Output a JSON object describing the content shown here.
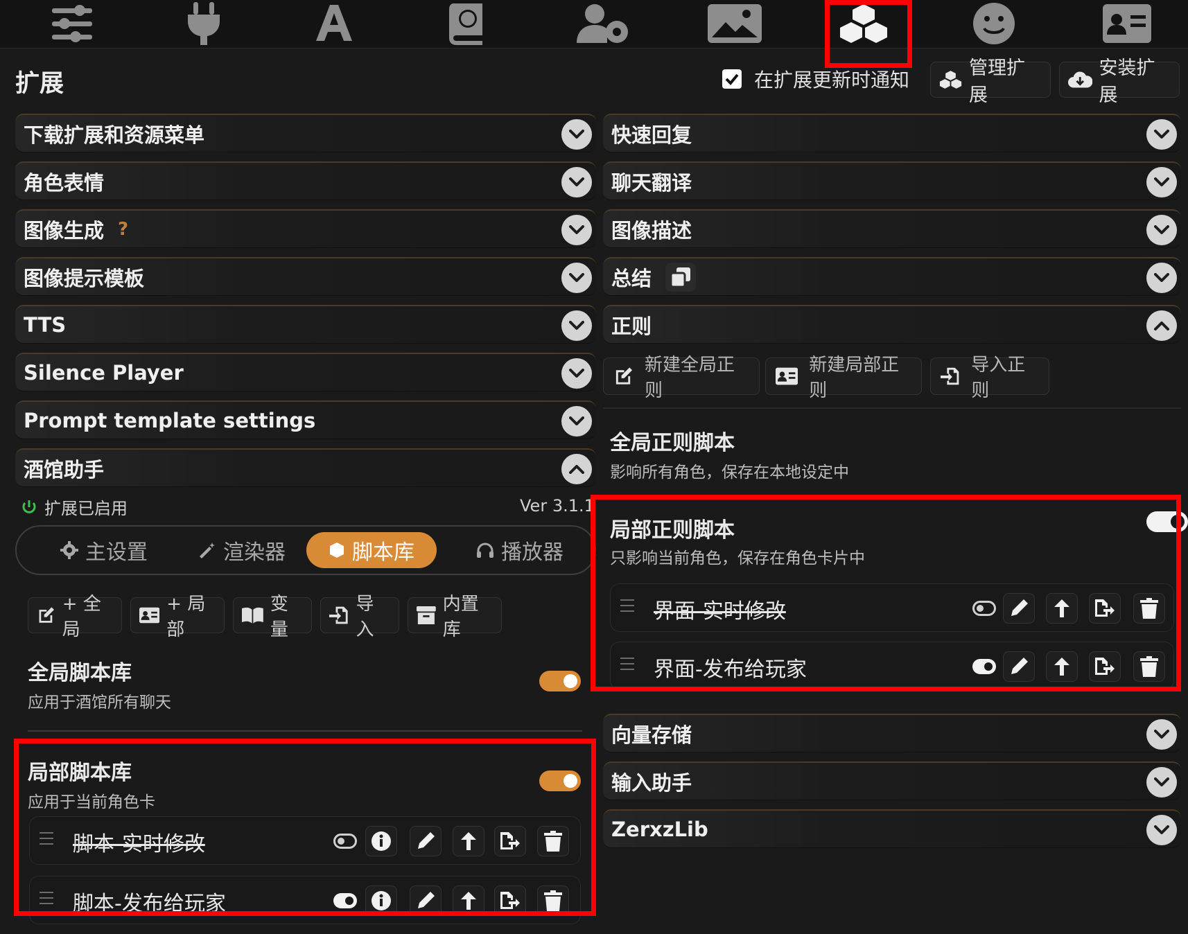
{
  "topnav": {
    "icons": [
      "sliders-icon",
      "plug-icon",
      "font-icon",
      "book-globe-icon",
      "user-gear-icon",
      "image-icon",
      "cubes-icon",
      "smiley-icon",
      "id-card-icon"
    ]
  },
  "header": {
    "title": "扩展",
    "notify_label": "在扩展更新时通知",
    "manage_label": "管理扩展",
    "install_label": "安装扩展"
  },
  "left": {
    "drawers": [
      "下载扩展和资源菜单",
      "角色表情",
      "图像生成",
      "图像提示模板",
      "TTS",
      "Silence Player",
      "Prompt template settings",
      "酒馆助手"
    ],
    "help_mark": "?",
    "helper": {
      "status": "扩展已启用",
      "version": "Ver 3.1.1",
      "tabs": [
        "主设置",
        "渲染器",
        "脚本库",
        "播放器"
      ],
      "active_tab": "脚本库",
      "toolbar": [
        "+ 全局",
        "+ 局部",
        "变量",
        "导入",
        "内置库"
      ],
      "global": {
        "title": "全局脚本库",
        "subtitle": "应用于酒馆所有聊天",
        "enabled": true
      },
      "local": {
        "title": "局部脚本库",
        "subtitle": "应用于当前角色卡",
        "enabled": true
      },
      "scripts": [
        {
          "name": "脚本-实时修改",
          "disabled": true
        },
        {
          "name": "脚本-发布给玩家",
          "disabled": false
        }
      ]
    }
  },
  "right": {
    "drawers_top": [
      "快速回复",
      "聊天翻译",
      "图像描述",
      "总结",
      "正则"
    ],
    "regex": {
      "buttons": [
        "新建全局正则",
        "新建局部正则",
        "导入正则"
      ],
      "global": {
        "title": "全局正则脚本",
        "subtitle": "影响所有角色，保存在本地设定中"
      },
      "local": {
        "title": "局部正则脚本",
        "subtitle": "只影响当前角色，保存在角色卡片中",
        "enabled": true
      },
      "scripts": [
        {
          "name": "界面-实时修改",
          "disabled": true
        },
        {
          "name": "界面-发布给玩家",
          "disabled": false
        }
      ]
    },
    "drawers_bottom": [
      "向量存储",
      "输入助手",
      "ZerxzLib"
    ]
  },
  "colors": {
    "accent": "#d98a35",
    "highlight": "#ff0000",
    "background": "#1a1a1a"
  }
}
